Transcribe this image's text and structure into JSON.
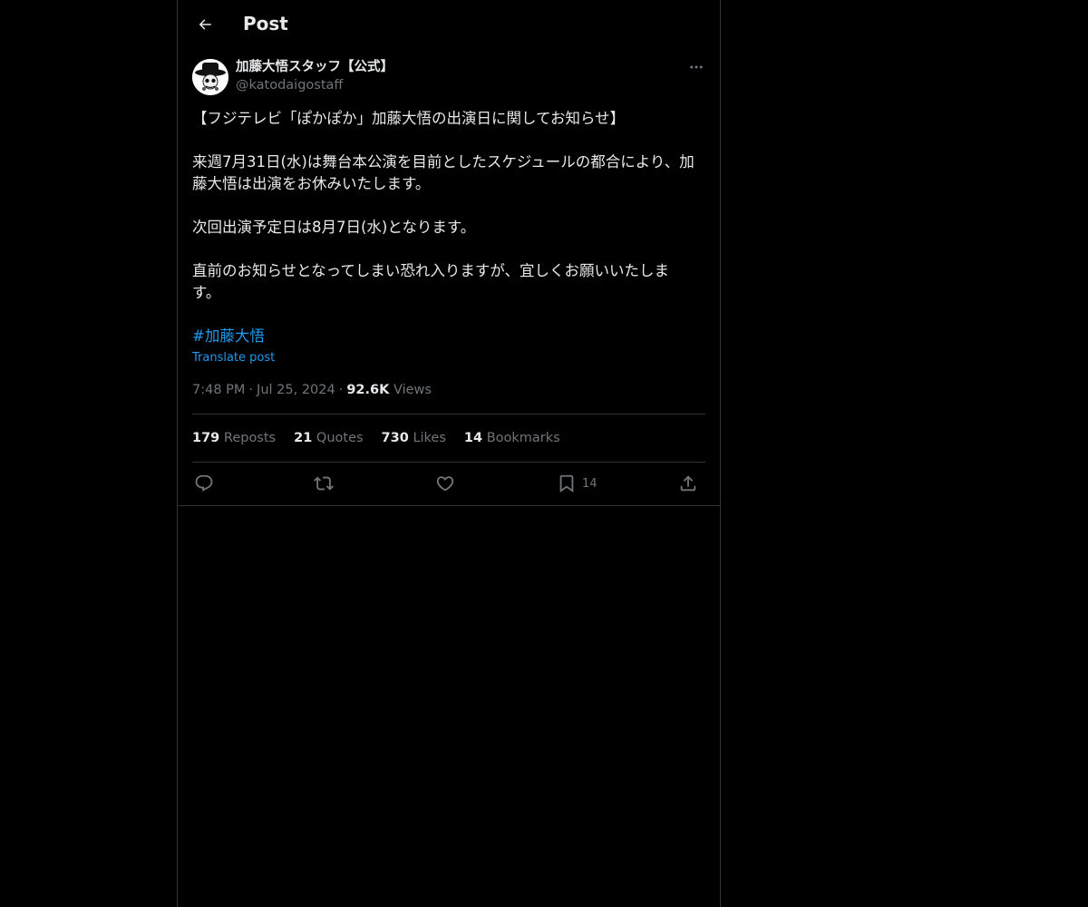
{
  "header": {
    "title": "Post",
    "back_icon": "back-arrow-icon"
  },
  "author": {
    "display_name": "加藤大悟スタッフ【公式】",
    "handle": "@katodaigostaff"
  },
  "tweet": {
    "lines": [
      "【フジテレビ「ぽかぽか」加藤大悟の出演日に関してお知らせ】",
      "",
      "来週7月31日(水)は舞台本公演を目前としたスケジュールの都合により、加",
      "藤大悟は出演をお休みいたします。",
      "",
      "次回出演予定日は8月7日(水)となります。",
      "",
      "直前のお知らせとなってしまい恐れ入りますが、宜しくお願いいたしま",
      "す。",
      ""
    ],
    "hashtag": "#加藤大悟",
    "translate_label": "Translate post"
  },
  "meta": {
    "time": "7:48 PM",
    "separator": "·",
    "date": "Jul 25, 2024",
    "views_count": "92.6K",
    "views_label": "Views"
  },
  "stats": {
    "reposts_count": "179",
    "reposts_label": "Reposts",
    "quotes_count": "21",
    "quotes_label": "Quotes",
    "likes_count": "730",
    "likes_label": "Likes",
    "bookmarks_count": "14",
    "bookmarks_label": "Bookmarks"
  },
  "actions": {
    "bookmark_count": "14"
  },
  "colors": {
    "background": "#000000",
    "text": "#e7e9ea",
    "secondary": "#71767b",
    "accent": "#1d9bf0",
    "border": "#2f3336"
  }
}
